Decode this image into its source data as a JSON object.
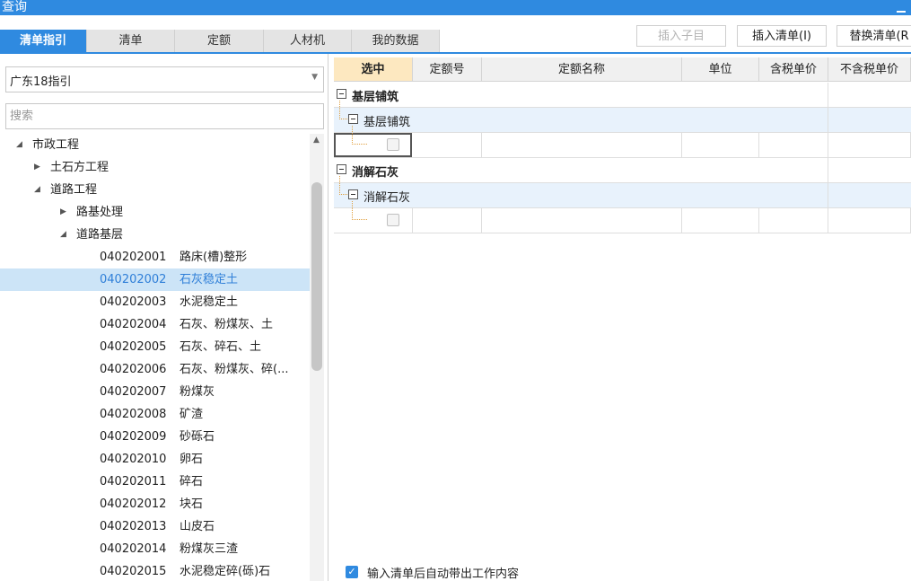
{
  "window": {
    "title": "查询"
  },
  "tabs": [
    {
      "label": "清单指引",
      "active": true
    },
    {
      "label": "清单",
      "active": false
    },
    {
      "label": "定额",
      "active": false
    },
    {
      "label": "人材机",
      "active": false
    },
    {
      "label": "我的数据",
      "active": false
    }
  ],
  "toolbar": {
    "insert_child": "插入子目",
    "insert_list": "插入清单(I)",
    "replace_list": "替换清单(R"
  },
  "guide_select": {
    "value": "广东18指引"
  },
  "search": {
    "placeholder": "搜索"
  },
  "tree": [
    {
      "label": "市政工程",
      "level": 0,
      "expanded": true
    },
    {
      "label": "土石方工程",
      "level": 1,
      "expanded": false
    },
    {
      "label": "道路工程",
      "level": 1,
      "expanded": true
    },
    {
      "label": "路基处理",
      "level": 2,
      "expanded": false
    },
    {
      "label": "道路基层",
      "level": 2,
      "expanded": true
    },
    {
      "code": "040202001",
      "name": "路床(槽)整形"
    },
    {
      "code": "040202002",
      "name": "石灰稳定土",
      "selected": true
    },
    {
      "code": "040202003",
      "name": "水泥稳定土"
    },
    {
      "code": "040202004",
      "name": "石灰、粉煤灰、土"
    },
    {
      "code": "040202005",
      "name": "石灰、碎石、土"
    },
    {
      "code": "040202006",
      "name": "石灰、粉煤灰、碎(..."
    },
    {
      "code": "040202007",
      "name": "粉煤灰"
    },
    {
      "code": "040202008",
      "name": "矿渣"
    },
    {
      "code": "040202009",
      "name": "砂砾石"
    },
    {
      "code": "040202010",
      "name": "卵石"
    },
    {
      "code": "040202011",
      "name": "碎石"
    },
    {
      "code": "040202012",
      "name": "块石"
    },
    {
      "code": "040202013",
      "name": "山皮石"
    },
    {
      "code": "040202014",
      "name": "粉煤灰三渣"
    },
    {
      "code": "040202015",
      "name": "水泥稳定碎(砾)石"
    }
  ],
  "grid": {
    "columns": [
      "选中",
      "定额号",
      "定额名称",
      "单位",
      "含税单价",
      "不含税单价"
    ],
    "groups": [
      {
        "title": "基层铺筑",
        "sub": "基层铺筑"
      },
      {
        "title": "消解石灰",
        "sub": "消解石灰"
      }
    ]
  },
  "auto_fill": {
    "label": "输入清单后自动带出工作内容",
    "checked": true
  }
}
